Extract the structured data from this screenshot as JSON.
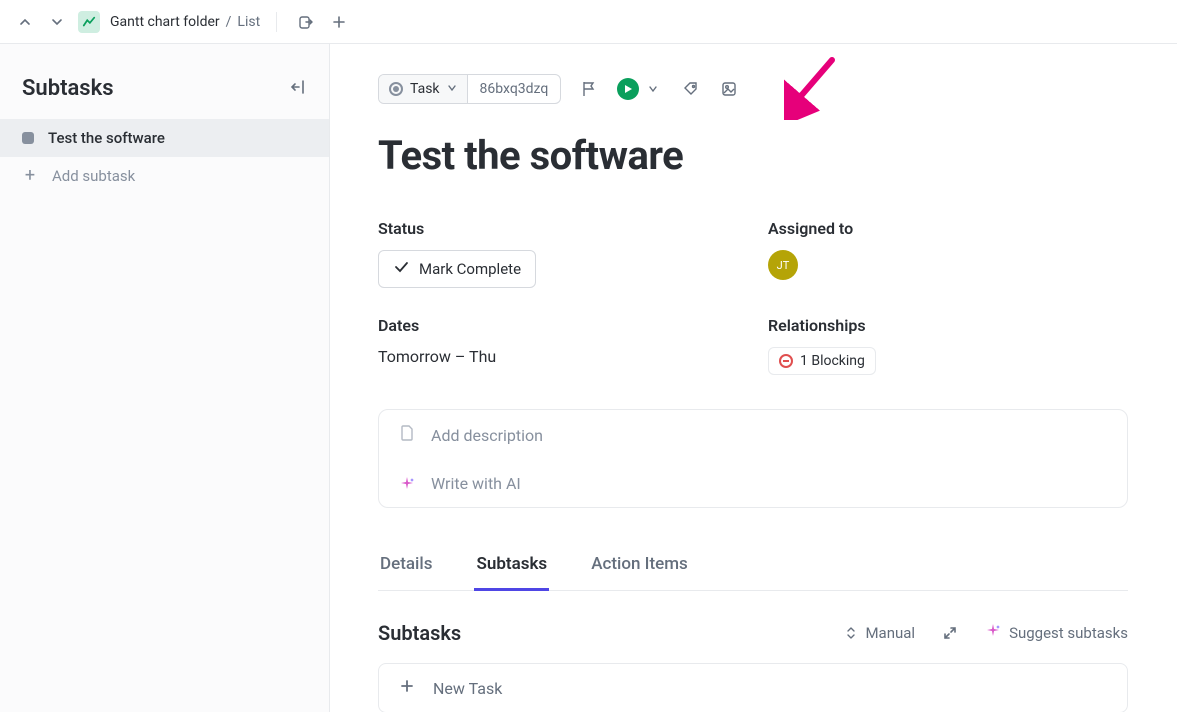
{
  "breadcrumb": {
    "folder": "Gantt chart folder",
    "view": "List"
  },
  "sidebar": {
    "title": "Subtasks",
    "items": [
      {
        "label": "Test the software"
      }
    ],
    "add_label": "Add subtask"
  },
  "task": {
    "type_label": "Task",
    "id": "86bxq3dzq",
    "title": "Test the software"
  },
  "fields": {
    "status_label": "Status",
    "status_button": "Mark Complete",
    "assigned_label": "Assigned to",
    "assignee_initials": "JT",
    "dates_label": "Dates",
    "dates_value": "Tomorrow – Thu",
    "relationships_label": "Relationships",
    "relationships_value": "1 Blocking"
  },
  "description": {
    "add_text": "Add description",
    "ai_text": "Write with AI"
  },
  "tabs": {
    "details": "Details",
    "subtasks": "Subtasks",
    "action_items": "Action Items"
  },
  "subtasks_section": {
    "heading": "Subtasks",
    "sort_label": "Manual",
    "suggest_label": "Suggest subtasks",
    "new_task_label": "New Task"
  }
}
